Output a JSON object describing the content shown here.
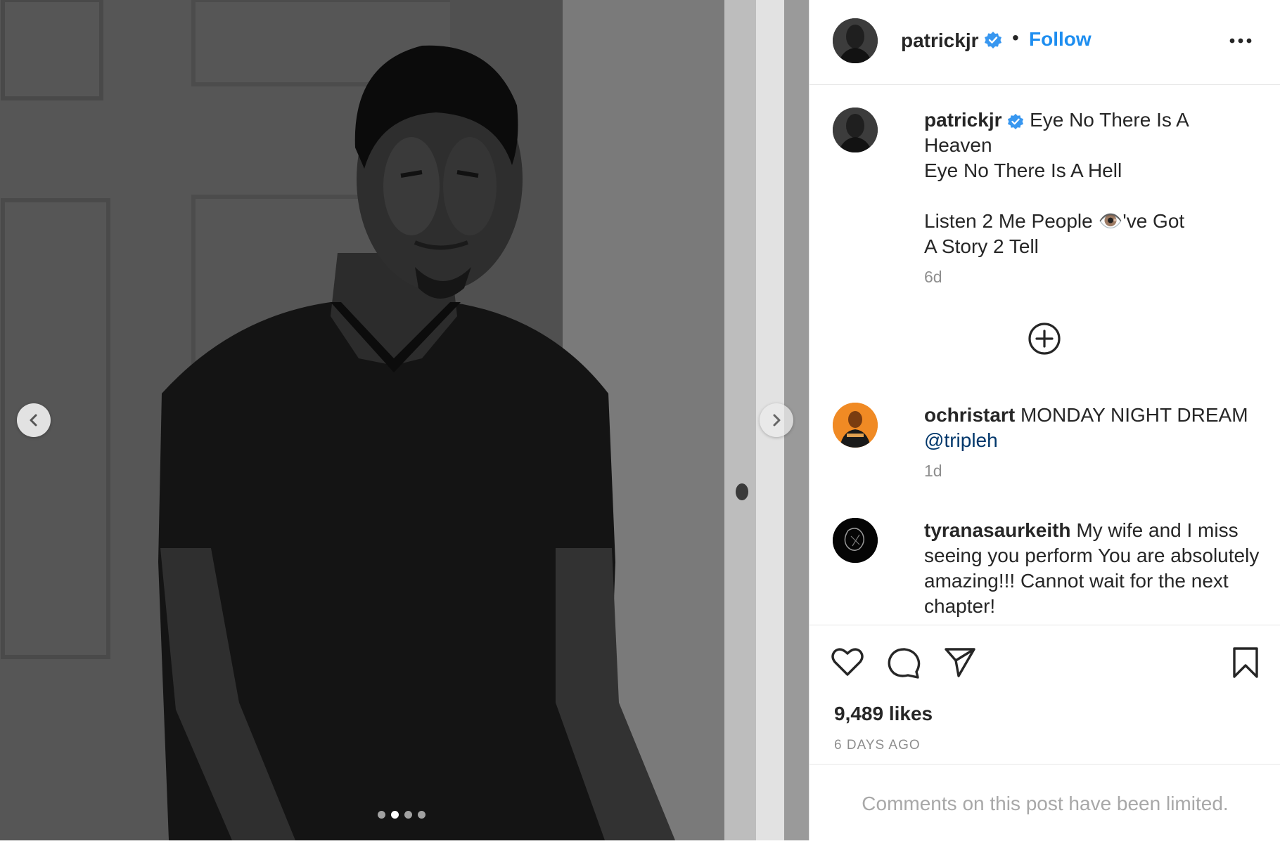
{
  "post": {
    "image_alt": "patrickjr photo",
    "carousel": {
      "total": 4,
      "active_index": 1
    }
  },
  "header": {
    "username": "patrickjr",
    "separator": "•",
    "follow_label": "Follow"
  },
  "caption": {
    "username": "patrickjr",
    "lines": [
      "Eye No There Is A",
      "Heaven",
      "Eye No There Is A Hell",
      "",
      "Listen 2 Me People 👁️'ve Got",
      "A Story 2 Tell"
    ],
    "time": "6d"
  },
  "comments": [
    {
      "username": "ochristart",
      "text": "MONDAY NIGHT DREAM",
      "mention": "@tripleh",
      "time": "1d"
    },
    {
      "username": "tyranasaurkeith",
      "text": "My wife and I miss seeing you perform You are absolutely amazing!!! Cannot wait for the next chapter!"
    }
  ],
  "likes": "9,489 likes",
  "post_age": "6 DAYS AGO",
  "comments_limited": "Comments on this post have been limited.",
  "colors": {
    "accent": "#0095f6",
    "verified": "#3897f0",
    "text": "#262626",
    "muted": "#8e8e8e"
  },
  "icons": [
    "chevron-left-icon",
    "chevron-right-icon",
    "more-icon",
    "verified-icon",
    "add-circle-icon",
    "heart-icon",
    "comment-icon",
    "share-icon",
    "bookmark-icon"
  ]
}
